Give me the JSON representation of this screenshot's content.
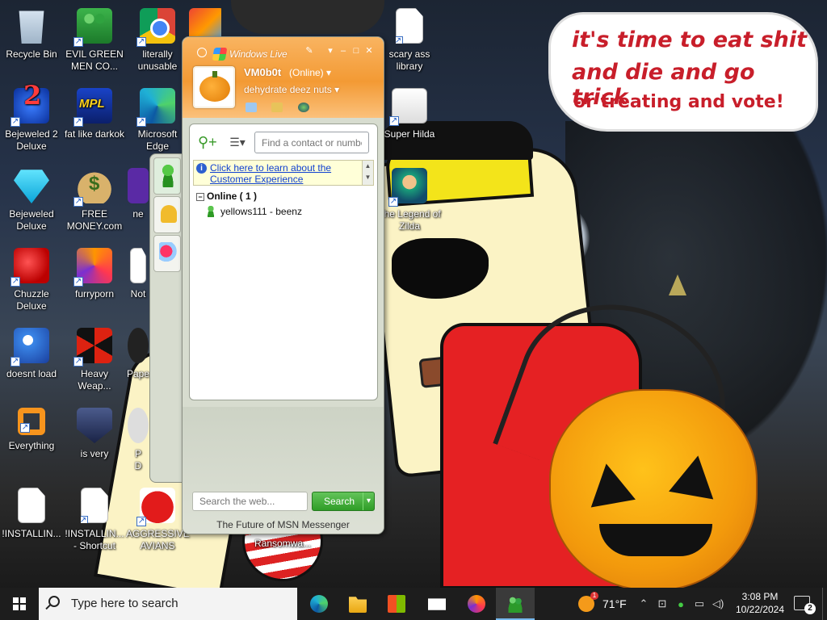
{
  "wallpaper": {
    "speech_line1": "it's time to eat shit",
    "speech_line2": "and die and go trick",
    "speech_line3": "or treating and vote!"
  },
  "desktop_icons": [
    {
      "label": "Recycle Bin",
      "icon": "recycle-bin-icon"
    },
    {
      "label": "EVIL GREEN MEN CO...",
      "icon": "msn-people-icon"
    },
    {
      "label": "literally unusable",
      "icon": "chrome-icon"
    },
    {
      "label": "scary ass library",
      "icon": "document-icon"
    },
    {
      "label": "Bejeweled 2 Deluxe",
      "icon": "bejeweled-2-icon"
    },
    {
      "label": "fat like darkok",
      "icon": "mpl-icon"
    },
    {
      "label": "Microsoft Edge",
      "icon": "edge-icon"
    },
    {
      "label": "Super Hilda",
      "icon": "hilda-icon"
    },
    {
      "label": "Bejeweled Deluxe",
      "icon": "gem-icon"
    },
    {
      "label": "FREE MONEY.com",
      "icon": "money-bag-icon"
    },
    {
      "label": "The Legend of Zilda",
      "icon": "zelda-icon"
    },
    {
      "label": "Chuzzle Deluxe",
      "icon": "chuzzle-icon"
    },
    {
      "label": "furryporn",
      "icon": "firefox-icon"
    },
    {
      "label": "doesnt load",
      "icon": "thunderbird-icon"
    },
    {
      "label": "Heavy Weap...",
      "icon": "radiation-icon"
    },
    {
      "label": "Everything",
      "icon": "everything-search-icon"
    },
    {
      "label": "is very",
      "icon": "shield-icon"
    },
    {
      "label": "!INSTALLIN...",
      "icon": "document-icon"
    },
    {
      "label": "!INSTALLIN... - Shortcut",
      "icon": "document-icon"
    },
    {
      "label": "AGGRESSIVE AVIANS",
      "icon": "angry-bird-icon"
    }
  ],
  "partial_labels": [
    "ne",
    "Not",
    "Pape",
    "P",
    "D",
    "Ransomwa..."
  ],
  "msn": {
    "title": "Windows Live",
    "username": "VM0b0t",
    "status": "(Online)",
    "personal_message": "dehydrate deez nuts",
    "find_placeholder": "Find a contact or number...",
    "ad_link": "Click here to learn about the Customer Experience",
    "group_label": "Online ( 1 )",
    "group_toggle": "−",
    "contact": "yellows111 - beenz",
    "web_search_placeholder": "Search the web...",
    "search_button": "Search",
    "footer": "The Future of MSN Messenger",
    "colors": {
      "header": "#f39a34",
      "search_button": "#2f9d27"
    }
  },
  "taskbar": {
    "search_placeholder": "Type here to search",
    "temperature": "71°F",
    "time": "3:08 PM",
    "date": "10/22/2024",
    "notification_count": "2",
    "weather_badge": "1",
    "apps": [
      "edge-icon",
      "file-explorer-icon",
      "store-icon",
      "mail-icon",
      "firefox-icon",
      "msn-messenger-icon"
    ]
  }
}
